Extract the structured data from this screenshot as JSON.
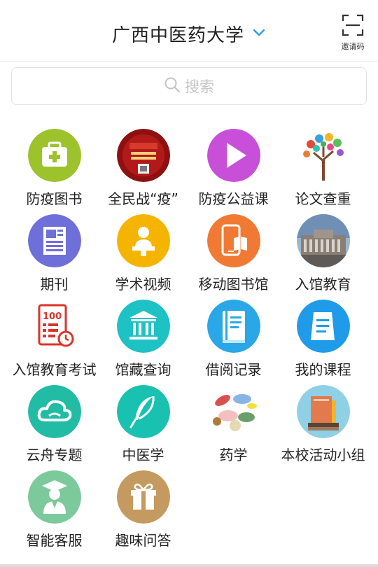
{
  "header": {
    "title": "广西中医药大学",
    "invite_label": "邀请码"
  },
  "search": {
    "placeholder": "搜索"
  },
  "colors": {
    "accent": "#2a9de8"
  },
  "grid": {
    "items": [
      {
        "label": "防疫图书",
        "icon": "medical-kit-icon",
        "color": "#9dc32c"
      },
      {
        "label": "全民战“疫”",
        "icon": "wuhan-poster-icon",
        "color": "#b21a1a"
      },
      {
        "label": "防疫公益课",
        "icon": "play-icon",
        "color": "#c84fd8"
      },
      {
        "label": "论文查重",
        "icon": "knowledge-tree-icon",
        "color": "#7b4a2c"
      },
      {
        "label": "期刊",
        "icon": "journal-icon",
        "color": "#6e6fd8"
      },
      {
        "label": "学术视频",
        "icon": "lecturer-icon",
        "color": "#f5b400"
      },
      {
        "label": "移动图书馆",
        "icon": "mobile-library-icon",
        "color": "#f07a33"
      },
      {
        "label": "入馆教育",
        "icon": "library-building-icon",
        "color": "#6f8fb4"
      },
      {
        "label": "入馆教育考试",
        "icon": "exam-score-icon",
        "color": "#d9352a"
      },
      {
        "label": "馆藏查询",
        "icon": "museum-icon",
        "color": "#1ec2c4"
      },
      {
        "label": "借阅记录",
        "icon": "borrow-record-icon",
        "color": "#29a7e6"
      },
      {
        "label": "我的课程",
        "icon": "course-icon",
        "color": "#1f9bea"
      },
      {
        "label": "云舟专题",
        "icon": "cloud-icon",
        "color": "#22bca4"
      },
      {
        "label": "中医学",
        "icon": "feather-icon",
        "color": "#19c1b0"
      },
      {
        "label": "药学",
        "icon": "pills-icon",
        "color": "#d85050"
      },
      {
        "label": "本校活动小组",
        "icon": "books-stack-icon",
        "color": "#8fd0e6"
      },
      {
        "label": "智能客服",
        "icon": "graduate-icon",
        "color": "#7cc99c"
      },
      {
        "label": "趣味问答",
        "icon": "gift-icon",
        "color": "#c49a60"
      }
    ]
  }
}
